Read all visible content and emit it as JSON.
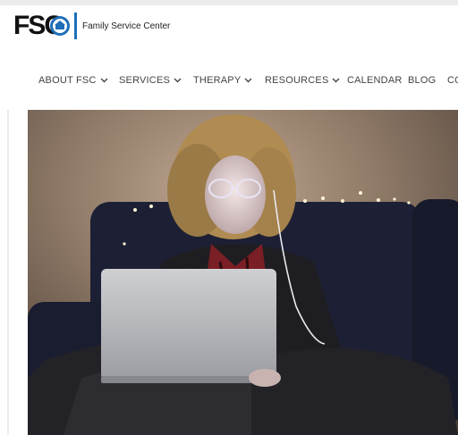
{
  "header": {
    "logo_text": "FSC",
    "org_name": "Family Service Center"
  },
  "nav": {
    "items": [
      {
        "label": "ABOUT FSC",
        "has_dropdown": true
      },
      {
        "label": "SERVICES",
        "has_dropdown": true
      },
      {
        "label": "THERAPY",
        "has_dropdown": true
      },
      {
        "label": "RESOURCES",
        "has_dropdown": true
      },
      {
        "label": "CALENDAR",
        "has_dropdown": false
      },
      {
        "label": "BLOG",
        "has_dropdown": false
      },
      {
        "label": "CO",
        "has_dropdown": false
      }
    ]
  },
  "colors": {
    "brand_blue": "#1e6fb8",
    "nav_text": "#444444"
  },
  "icons": [
    "chevron-down-icon",
    "logo-seal-icon"
  ]
}
